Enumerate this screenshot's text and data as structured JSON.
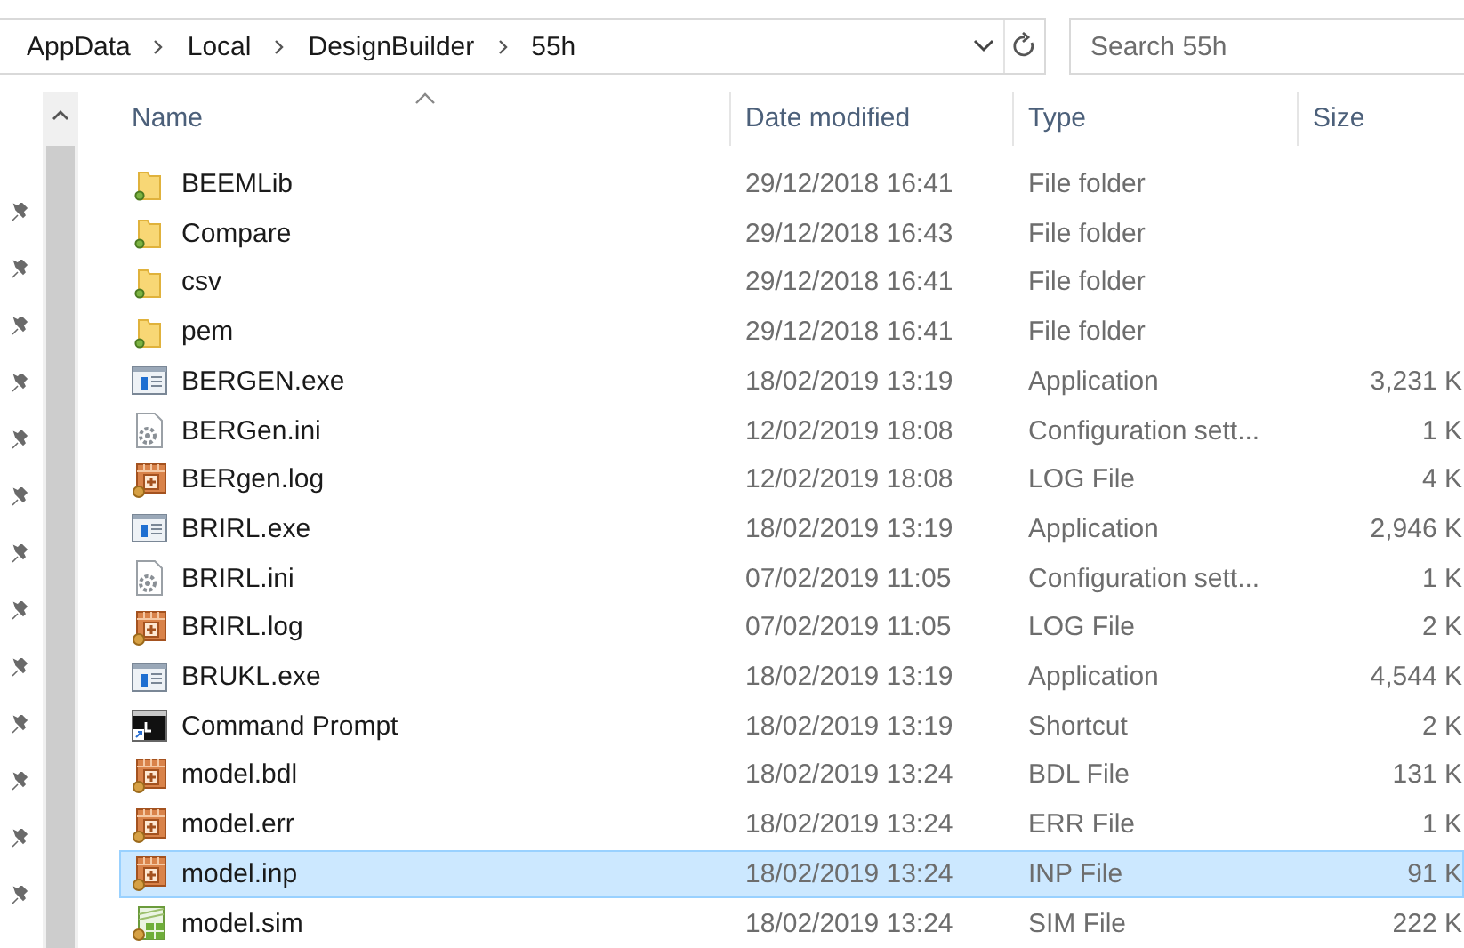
{
  "address_bar": {
    "path": [
      {
        "label": "AppData"
      },
      {
        "label": "Local"
      },
      {
        "label": "DesignBuilder"
      },
      {
        "label": "55h"
      }
    ]
  },
  "search": {
    "placeholder": "Search 55h"
  },
  "columns": [
    {
      "label": "Name",
      "sorted": true
    },
    {
      "label": "Date modified",
      "sorted": false
    },
    {
      "label": "Type",
      "sorted": false
    },
    {
      "label": "Size",
      "sorted": false
    }
  ],
  "files": [
    {
      "name": "BEEMLib",
      "date": "29/12/2018 16:41",
      "type": "File folder",
      "kind": "folder",
      "selected": false
    },
    {
      "name": "Compare",
      "date": "29/12/2018 16:43",
      "type": "File folder",
      "kind": "folder",
      "selected": false
    },
    {
      "name": "csv",
      "date": "29/12/2018 16:41",
      "type": "File folder",
      "kind": "folder",
      "selected": false
    },
    {
      "name": "pem",
      "date": "29/12/2018 16:41",
      "type": "File folder",
      "kind": "folder",
      "selected": false
    },
    {
      "name": "BERGEN.exe",
      "date": "18/02/2019 13:19",
      "type": "Application",
      "size": "3,231 K",
      "kind": "exe",
      "selected": false
    },
    {
      "name": "BERGen.ini",
      "date": "12/02/2019 18:08",
      "type": "Configuration sett...",
      "size": "1 K",
      "kind": "ini",
      "selected": false
    },
    {
      "name": "BERgen.log",
      "date": "12/02/2019 18:08",
      "type": "LOG File",
      "size": "4 K",
      "kind": "log",
      "selected": false
    },
    {
      "name": "BRIRL.exe",
      "date": "18/02/2019 13:19",
      "type": "Application",
      "size": "2,946 K",
      "kind": "exe",
      "selected": false
    },
    {
      "name": "BRIRL.ini",
      "date": "07/02/2019 11:05",
      "type": "Configuration sett...",
      "size": "1 K",
      "kind": "ini",
      "selected": false
    },
    {
      "name": "BRIRL.log",
      "date": "07/02/2019 11:05",
      "type": "LOG File",
      "size": "2 K",
      "kind": "log",
      "selected": false
    },
    {
      "name": "BRUKL.exe",
      "date": "18/02/2019 13:19",
      "type": "Application",
      "size": "4,544 K",
      "kind": "exe",
      "selected": false
    },
    {
      "name": "Command Prompt",
      "date": "18/02/2019 13:19",
      "type": "Shortcut",
      "size": "2 K",
      "kind": "shortcut",
      "selected": false
    },
    {
      "name": "model.bdl",
      "date": "18/02/2019 13:24",
      "type": "BDL File",
      "size": "131 K",
      "kind": "log",
      "selected": false
    },
    {
      "name": "model.err",
      "date": "18/02/2019 13:24",
      "type": "ERR File",
      "size": "1 K",
      "kind": "log",
      "selected": false
    },
    {
      "name": "model.inp",
      "date": "18/02/2019 13:24",
      "type": "INP File",
      "size": "91 K",
      "kind": "log",
      "selected": true
    },
    {
      "name": "model.sim",
      "date": "18/02/2019 13:24",
      "type": "SIM File",
      "size": "222 K",
      "kind": "sim",
      "selected": false
    }
  ]
}
